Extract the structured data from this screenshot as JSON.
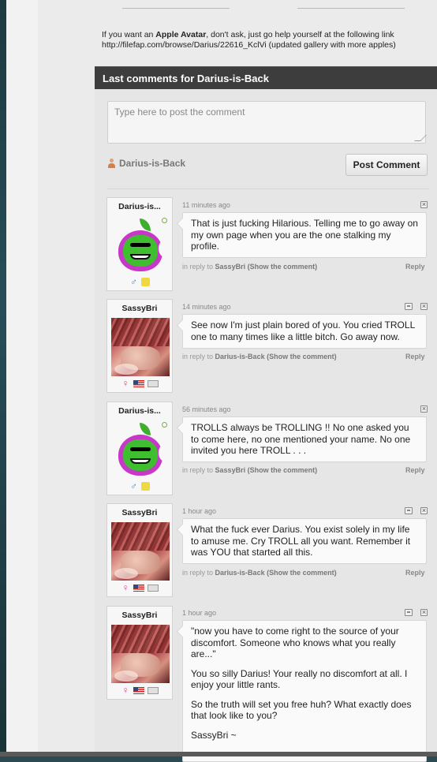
{
  "avatar_note": {
    "prefix": "If you want an ",
    "bold": "Apple Avatar",
    "suffix": ", don't ask, just go help yourself at the following link",
    "link": "http://filefap.com/browse/Darius/22616_KclVi (updated gallery with more apples)"
  },
  "section": {
    "title": "Last comments for Darius-is-Back"
  },
  "compose": {
    "placeholder": "Type here to post the comment",
    "poster_name": "Darius-is-Back",
    "post_label": "Post Comment"
  },
  "comments": [
    {
      "user": "Darius-is...",
      "time": "11 minutes ago",
      "text": [
        "That is just fucking Hilarious. Telling me to go away on my own page when you are the one stalking my profile."
      ],
      "reply_prefix": "in reply to",
      "reply_to": "SassyBri",
      "show": "(Show the comment)",
      "reply": "Reply"
    },
    {
      "user": "SassyBri",
      "time": "14 minutes ago",
      "text": [
        "See now I'm just plain bored of you. You cried TROLL one to many times like a little bitch. Go away now."
      ],
      "reply_prefix": "in reply to",
      "reply_to": "Darius-is-Back",
      "show": "(Show the comment)",
      "reply": "Reply"
    },
    {
      "user": "Darius-is...",
      "time": "56 minutes ago",
      "text": [
        "TROLLS always be TROLLING !! No one asked you to come here, no one mentioned your name. No one invited you here TROLL . . ."
      ],
      "reply_prefix": "in reply to",
      "reply_to": "SassyBri",
      "show": "(Show the comment)",
      "reply": "Reply"
    },
    {
      "user": "SassyBri",
      "time": "1 hour ago",
      "text": [
        "What the fuck ever Darius. You exist solely in my life to amuse me. Cry TROLL all you want. Remember it was YOU that started all this."
      ],
      "reply_prefix": "in reply to",
      "reply_to": "Darius-is-Back",
      "show": "(Show the comment)",
      "reply": "Reply"
    },
    {
      "user": "SassyBri",
      "time": "1 hour ago",
      "text": [
        "\"now you have to come right to the source of your discomfort. Someone who knows what you really are...\"",
        "You so silly Darius! Your really no discomfort at all. I enjoy your little rants.",
        "So the truth will set you free huh? What exactly does that look like to you?",
        "SassyBri ~"
      ]
    }
  ],
  "icons": {
    "male": "♂",
    "female": "♀",
    "close": "×"
  }
}
